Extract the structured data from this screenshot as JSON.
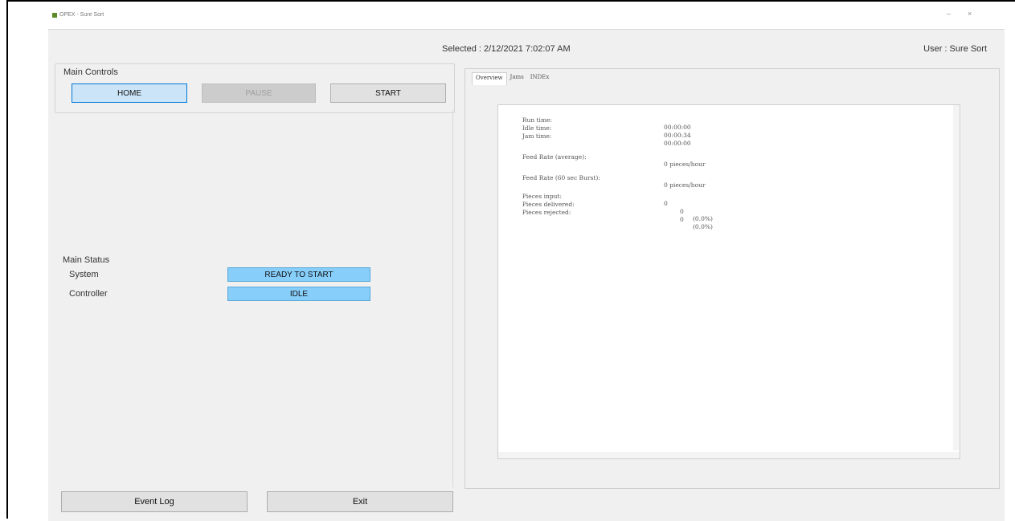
{
  "window": {
    "title": "OPEX - Sure Sort"
  },
  "header": {
    "selected": "Selected : 2/12/2021 7:02:07 AM",
    "user": "User : Sure Sort"
  },
  "controls": {
    "title": "Main Controls",
    "home": "HOME",
    "pause": "PAUSE",
    "start": "START"
  },
  "status": {
    "title": "Main Status",
    "system_label": "System",
    "system_value": "READY TO START",
    "controller_label": "Controller",
    "controller_value": "IDLE"
  },
  "tabs": [
    "Overview",
    "Jams",
    "INDEx"
  ],
  "overview": {
    "run_time_label": "Run time:",
    "run_time": "00:00:00",
    "idle_time_label": "Idle time:",
    "idle_time": "00:00:34",
    "jam_time_label": "Jam time:",
    "jam_time": "00:00:00",
    "feed_avg_label": "Feed Rate (average):",
    "feed_avg": "0 pieces/hour",
    "feed_burst_label": "Feed Rate (60 sec Burst):",
    "feed_burst": "0 pieces/hour",
    "input_label": "Pieces input:",
    "input": "0",
    "delivered_label": "Pieces delivered:",
    "delivered": "0",
    "delivered_pct": "(0.0%)",
    "rejected_label": "Pieces rejected:",
    "rejected": "0",
    "rejected_pct": "(0.0%)"
  },
  "footer": {
    "event_log": "Event Log",
    "exit": "Exit"
  },
  "colors": {
    "status_bg": "#87cefa",
    "home_bg": "#cce4f7",
    "app_bg": "#f0f0f0"
  }
}
